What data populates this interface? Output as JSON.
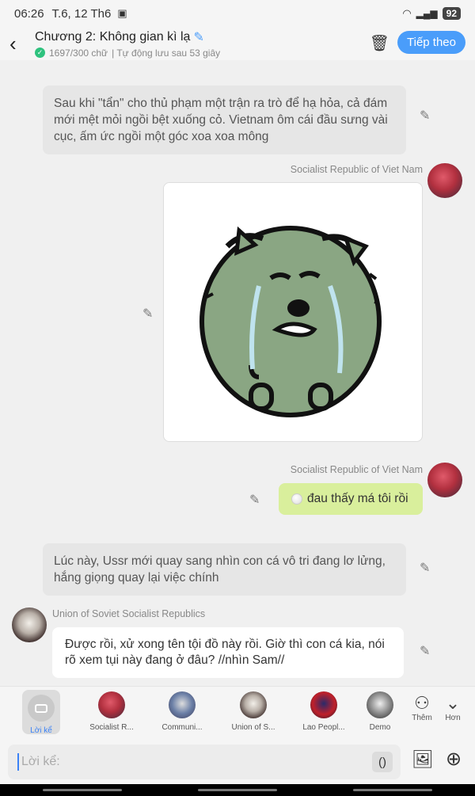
{
  "status_bar": {
    "time": "06:26",
    "date": "T.6, 12 Th6",
    "battery": "92"
  },
  "header": {
    "title": "Chương 2: Không gian kì lạ",
    "word_count": "1697/300 chữ",
    "autosave": "| Tự động lưu sau 53 giây",
    "next_button": "Tiếp theo"
  },
  "messages": {
    "narration_1": "Sau khi \"tẩn\" cho thủ phạm một trận ra trò để hạ hỏa, cả đám mới mệt mỏi ngồi bệt xuống cỏ. Vietnam ôm cái đầu sưng vài cục, ấm ức ngồi một góc xoa xoa mông",
    "speaker_vn_1": "Socialist Republic of Viet Nam",
    "speaker_vn_2": "Socialist Republic of Viet Nam",
    "vn_reply": "đau thấy má tôi rồi",
    "narration_2": "Lúc này, Ussr mới quay sang nhìn con cá vô tri đang lơ lửng, hắng giọng quay lại việc chính",
    "speaker_ussr": "Union of Soviet Socialist Republics",
    "ussr_reply": "Được rồi, xử xong tên tội đồ này rồi. Giờ thì con cá kia, nói rõ xem tụi này đang ở đâu? //nhìn Sam//"
  },
  "character_tray": {
    "items": [
      {
        "label": "Lời kể"
      },
      {
        "label": "Socialist R..."
      },
      {
        "label": "Communi..."
      },
      {
        "label": "Union of S..."
      },
      {
        "label": "Lao Peopl..."
      },
      {
        "label": "Demo"
      }
    ],
    "add_label": "Thêm",
    "more_label": "Hơn"
  },
  "composer": {
    "placeholder": "Lời kể:",
    "paren": "()"
  }
}
